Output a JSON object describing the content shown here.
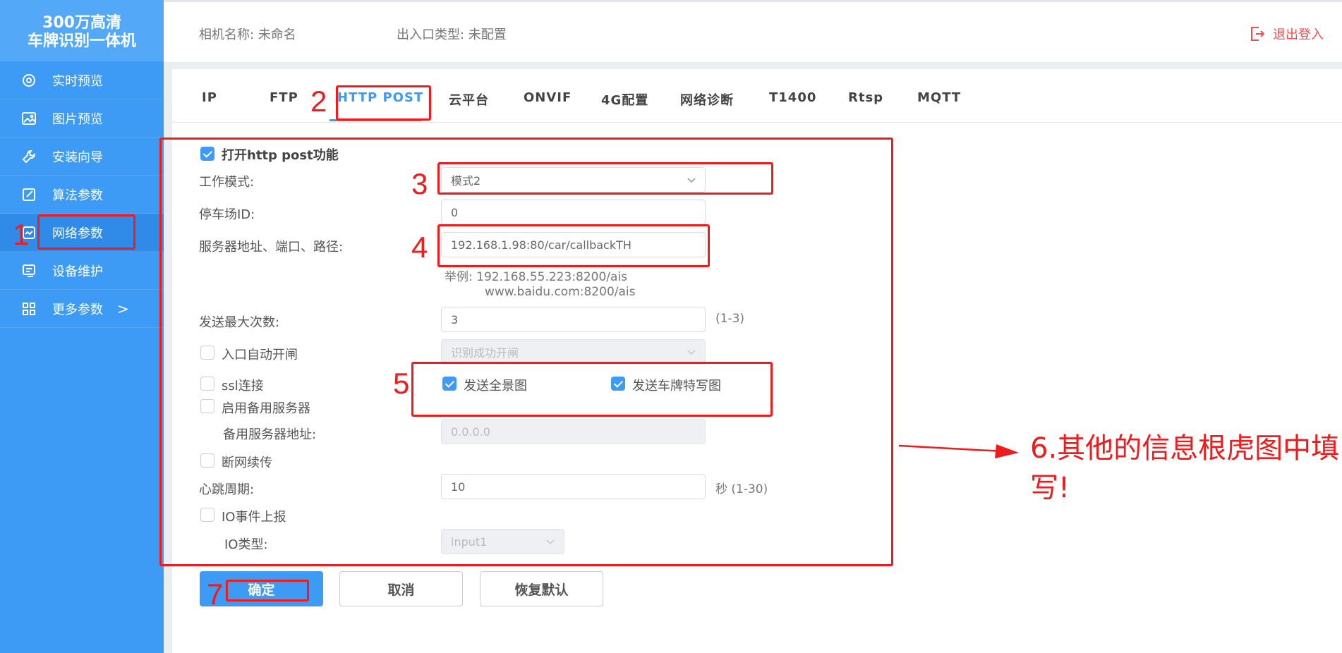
{
  "brand": {
    "line1": "300万高清",
    "line2": "车牌识别一体机"
  },
  "sidebar": {
    "items": [
      {
        "label": "实时预览",
        "icon": "live-preview-icon"
      },
      {
        "label": "图片预览",
        "icon": "image-icon"
      },
      {
        "label": "安装向导",
        "icon": "wrench-icon"
      },
      {
        "label": "算法参数",
        "icon": "edit-icon"
      },
      {
        "label": "网络参数",
        "icon": "network-icon"
      },
      {
        "label": "设备维护",
        "icon": "maintenance-icon"
      },
      {
        "label": "更多参数",
        "icon": "grid-icon",
        "arrow": ">"
      }
    ],
    "active": "网络参数"
  },
  "header": {
    "camera_name": "相机名称: 未命名",
    "gate_type": "出入口类型: 未配置",
    "logout": "退出登入"
  },
  "tabs": [
    "IP",
    "FTP",
    "HTTP POST",
    "云平台",
    "ONVIF",
    "4G配置",
    "网络诊断",
    "T1400",
    "Rtsp",
    "MQTT"
  ],
  "active_tab": "HTTP POST",
  "form": {
    "enable_label": "打开http post功能",
    "enable_checked": true,
    "work_mode_label": "工作模式:",
    "work_mode_value": "模式2",
    "parking_id_label": "停车场ID:",
    "parking_id_value": "0",
    "server_label": "服务器地址、端口、路径:",
    "server_value": "192.168.1.98:80/car/callbackTH",
    "example_line1": "举例:  192.168.55.223:8200/ais",
    "example_line2": "www.baidu.com:8200/ais",
    "max_send_label": "发送最大次数:",
    "max_send_value": "3",
    "max_send_range": "(1-3)",
    "auto_gate_label": "入口自动开闸",
    "auto_gate_checked": false,
    "auto_gate_value": "识别成功开闸",
    "ssl_label": "ssl连接",
    "ssl_checked": false,
    "send_full_label": "发送全景图",
    "send_full_checked": true,
    "send_plate_label": "发送车牌特写图",
    "send_plate_checked": true,
    "backup_server_label": "启用备用服务器",
    "backup_server_checked": false,
    "backup_addr_label": "备用服务器地址:",
    "backup_addr_value": "0.0.0.0",
    "resume_label": "断网续传",
    "resume_checked": false,
    "heartbeat_label": "心跳周期:",
    "heartbeat_value": "10",
    "heartbeat_unit": "秒  (1-30)",
    "io_report_label": "IO事件上报",
    "io_report_checked": false,
    "io_type_label": "IO类型:",
    "io_type_value": "input1"
  },
  "buttons": {
    "confirm": "确定",
    "cancel": "取消",
    "reset": "恢复默认"
  },
  "annotations": {
    "steps": [
      "1",
      "2",
      "3",
      "4",
      "5",
      "7"
    ],
    "note": "6.其他的信息根虎图中填写!",
    "color": "#ee1c1c"
  }
}
